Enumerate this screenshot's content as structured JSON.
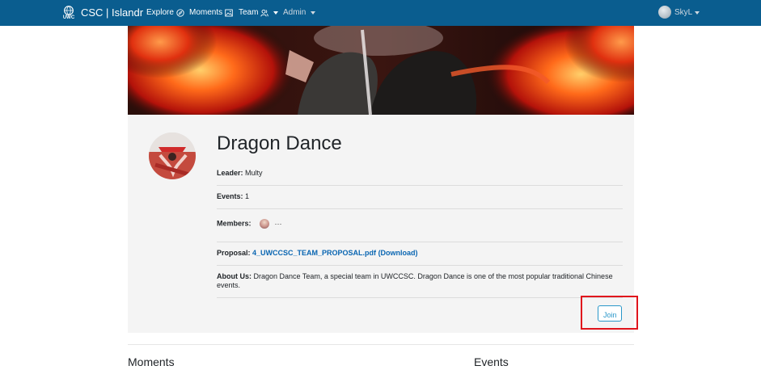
{
  "navbar": {
    "logo_text": "UWC",
    "title": "CSC | Islandr",
    "items": [
      {
        "label": "Explore",
        "icon": "compass-icon"
      },
      {
        "label": "Moments",
        "icon": "image-icon"
      },
      {
        "label": "Team",
        "icon": "users-icon"
      },
      {
        "label": "Admin"
      }
    ],
    "user": {
      "name": "SkyL"
    }
  },
  "team": {
    "name": "Dragon Dance",
    "leader_label": "Leader:",
    "leader": "Multy",
    "events_label": "Events:",
    "events": "1",
    "members_label": "Members:",
    "members_more": "···",
    "proposal_label": "Proposal:",
    "proposal_file": "4_UWCCSC_TEAM_PROPOSAL.pdf",
    "proposal_download": "(Download)",
    "about_label": "About Us:",
    "about": "Dragon Dance Team, a special team in UWCCSC. Dragon Dance is one of the most popular traditional Chinese events.",
    "join_label": "Join"
  },
  "sections": {
    "moments": "Moments",
    "events": "Events"
  },
  "colors": {
    "navbar": "#0a5d8f",
    "link": "#0a66b2",
    "join_outline": "#2a97c9",
    "highlight": "#e0141c"
  }
}
